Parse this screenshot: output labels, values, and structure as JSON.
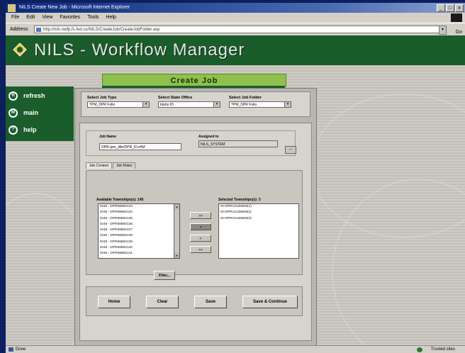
{
  "window": {
    "title": "NILS Create New Job - Microsoft Internet Explorer"
  },
  "menu": {
    "items": [
      "File",
      "Edit",
      "View",
      "Favorites",
      "Tools",
      "Help"
    ]
  },
  "address": {
    "label": "Address",
    "url": "http://nils.nwfp.fs.fed.us/NILS/CreateJob/CreateJobFolder.asp",
    "go_label": "Go"
  },
  "app": {
    "title": "NILS - Workflow Manager"
  },
  "page": {
    "tab_title": "Create Job"
  },
  "sidebar": {
    "items": [
      {
        "label": "refresh",
        "icon": "refresh-icon"
      },
      {
        "label": "main",
        "icon": "home-icon"
      },
      {
        "label": "help",
        "icon": "help-icon"
      }
    ]
  },
  "selectors": {
    "job_type": {
      "label": "Select Job Type",
      "value": "TPM_DPR Folio"
    },
    "state_office": {
      "label": "Select State Office",
      "value": "Idaho ID"
    },
    "job_folder": {
      "label": "Select Job Folder",
      "value": "TPM_DPR Folio"
    }
  },
  "job": {
    "name_label": "Job Name",
    "name_value": "DPR-tpm_title/DPR_ID+HM",
    "assigned_label": "Assigned to",
    "assigned_value": "NILS_SYSTEM",
    "browse_label": "..."
  },
  "tabs": [
    {
      "label": "Job Content",
      "active": true
    },
    {
      "label": "Job Notes",
      "active": false
    }
  ],
  "available": {
    "label": "Available Townships(s): 145",
    "items": [
      "ID48 - DPR98860133",
      "ID48 - DPR98860134",
      "ID48 - DPR98860135",
      "ID48 - DPR98860136",
      "ID48 - DPR98860137",
      "ID48 - DPR98860138",
      "ID48 - DPR98860139",
      "ID48 - DPR98860140",
      "ID48 - DPR98860141"
    ]
  },
  "selected": {
    "label": "Selected Townships(s): 3",
    "items": [
      "ID-DPR10138609(1)",
      "ID-DPR10138609(2)",
      "ID-DPR10138609(3)"
    ]
  },
  "move_buttons": [
    ">>",
    ">",
    "<",
    "<<"
  ],
  "filter_label": "Filter...",
  "actions": {
    "home": "Home",
    "clear": "Clear",
    "save": "Save",
    "save_continue": "Save & Continue"
  },
  "status": {
    "left": "Done",
    "right": "Trusted sites"
  }
}
